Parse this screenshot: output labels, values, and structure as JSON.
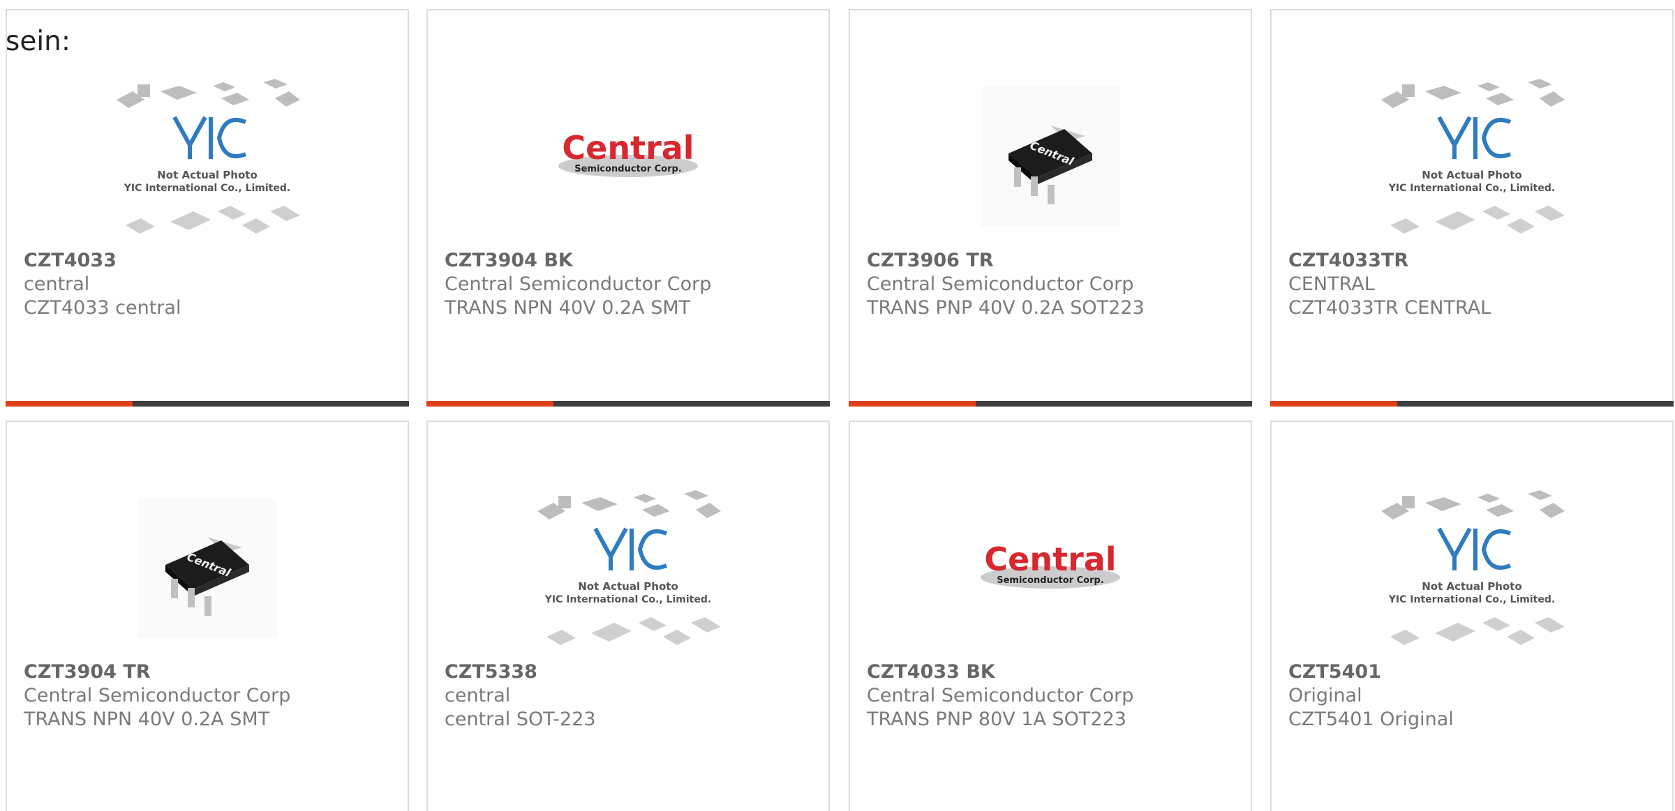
{
  "intro": {
    "text": "sein:"
  },
  "image_texts": {
    "placeholder_line1": "Not Actual Photo",
    "placeholder_line2": "YIC International Co., Limited.",
    "placeholder_logo": "YIC",
    "central_logo_main": "Central",
    "central_logo_sub": "Semiconductor Corp.",
    "chip_marking": "Central"
  },
  "colors": {
    "accent_bar": "#e0401a",
    "dark_bar": "#3f3f3f",
    "central_red": "#d7282f",
    "yic_blue": "#2f7bbf"
  },
  "products": [
    {
      "part": "CZT4033",
      "manufacturer": "central",
      "description": "CZT4033 central",
      "image": "yic-placeholder"
    },
    {
      "part": "CZT3904 BK",
      "manufacturer": "Central Semiconductor Corp",
      "description": "TRANS NPN 40V 0.2A SMT",
      "image": "central-logo"
    },
    {
      "part": "CZT3906 TR",
      "manufacturer": "Central Semiconductor Corp",
      "description": "TRANS PNP 40V 0.2A SOT223",
      "image": "sot223-chip-photo"
    },
    {
      "part": "CZT4033TR",
      "manufacturer": "CENTRAL",
      "description": "CZT4033TR CENTRAL",
      "image": "yic-placeholder"
    },
    {
      "part": "CZT3904 TR",
      "manufacturer": "Central Semiconductor Corp",
      "description": "TRANS NPN 40V 0.2A SMT",
      "image": "sot223-chip-photo"
    },
    {
      "part": "CZT5338",
      "manufacturer": "central",
      "description": "central SOT-223",
      "image": "yic-placeholder"
    },
    {
      "part": "CZT4033 BK",
      "manufacturer": "Central Semiconductor Corp",
      "description": "TRANS PNP 80V 1A SOT223",
      "image": "central-logo"
    },
    {
      "part": "CZT5401",
      "manufacturer": "Original",
      "description": "CZT5401 Original",
      "image": "yic-placeholder"
    }
  ]
}
